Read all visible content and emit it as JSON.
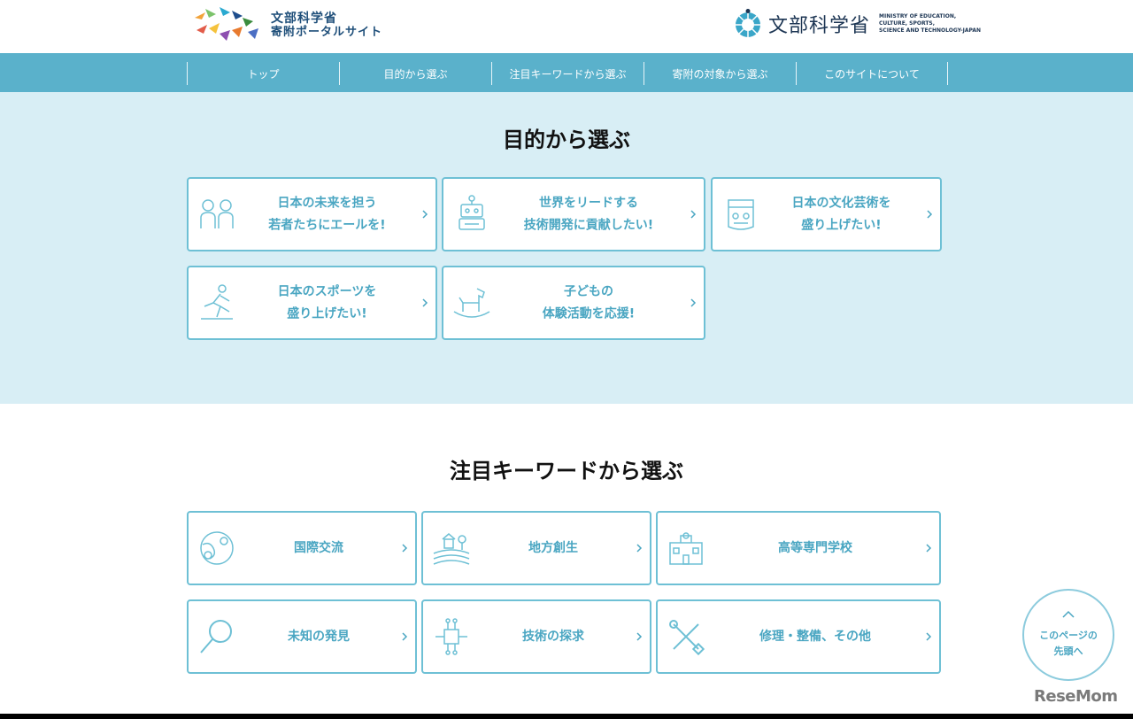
{
  "header": {
    "portal_logo_line1": "文部科学省",
    "portal_logo_line2": "寄附ポータルサイト",
    "mext_logo_jp": "文部科学省",
    "mext_logo_en": [
      "MINISTRY OF EDUCATION,",
      "CULTURE, SPORTS,",
      "SCIENCE AND TECHNOLOGY-JAPAN"
    ]
  },
  "nav": {
    "items": [
      {
        "label": "トップ"
      },
      {
        "label": "目的から選ぶ"
      },
      {
        "label": "注目キーワードから選ぶ"
      },
      {
        "label": "寄附の対象から選ぶ"
      },
      {
        "label": "このサイトについて"
      }
    ]
  },
  "purpose": {
    "title": "目的から選ぶ",
    "cards": [
      {
        "line1": "日本の未来を担う",
        "line2": "若者たちにエールを!",
        "icon": "people-icon"
      },
      {
        "line1": "世界をリードする",
        "line2": "技術開発に貢献したい!",
        "icon": "robot-icon"
      },
      {
        "line1": "日本の文化芸術を",
        "line2": "盛り上げたい!",
        "icon": "culture-icon"
      },
      {
        "line1": "日本のスポーツを",
        "line2": "盛り上げたい!",
        "icon": "runner-icon"
      },
      {
        "line1": "子どもの",
        "line2": "体験活動を応援!",
        "icon": "rocking-horse-icon"
      }
    ]
  },
  "keywords": {
    "title": "注目キーワードから選ぶ",
    "cards": [
      {
        "label": "国際交流",
        "icon": "globe-people-icon"
      },
      {
        "label": "地方創生",
        "icon": "countryside-icon"
      },
      {
        "label": "高等専門学校",
        "icon": "school-icon"
      },
      {
        "label": "未知の発見",
        "icon": "magnifier-icon"
      },
      {
        "label": "技術の探求",
        "icon": "chip-icon"
      },
      {
        "label": "修理・整備、その他",
        "icon": "tools-icon"
      }
    ]
  },
  "to_top": {
    "line1": "このページの",
    "line2": "先頭へ"
  },
  "watermark": "ReseMom",
  "colors": {
    "nav_bg": "#5ab1cb",
    "section_bg": "#d8eef5",
    "card_border": "#6ec0d5",
    "card_text": "#4aa6c2"
  }
}
